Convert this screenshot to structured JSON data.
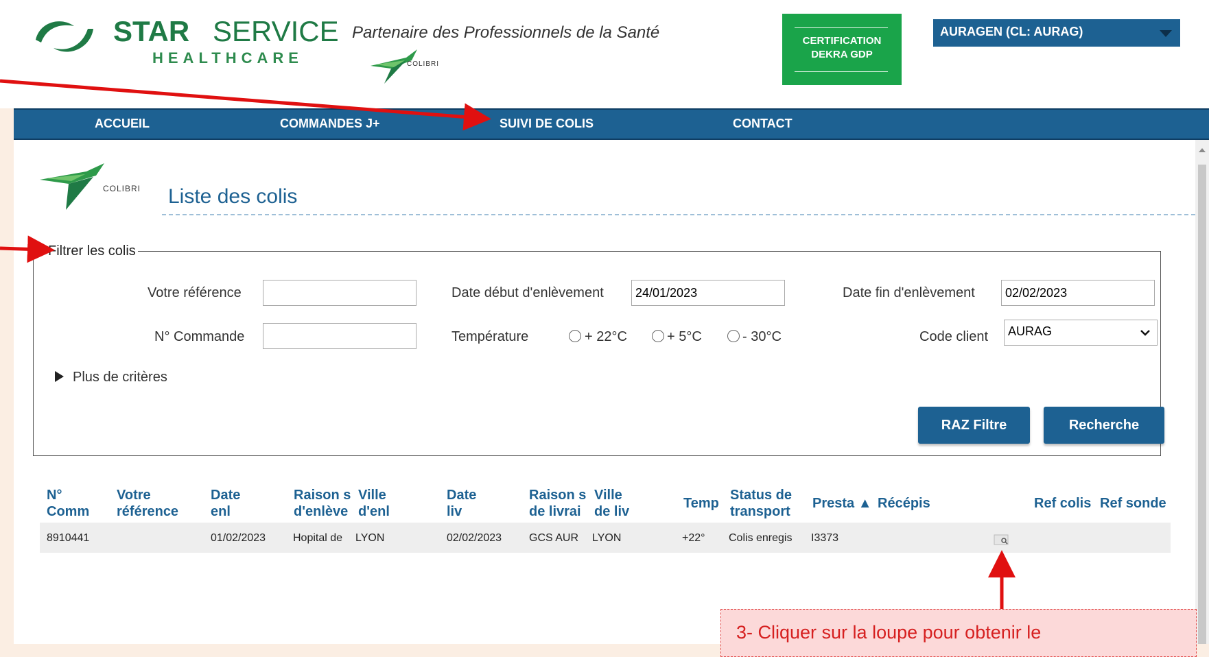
{
  "brand": {
    "name_bold": "STAR",
    "name_light": "SERVICE",
    "subline": "HEALTHCARE",
    "tagline": "Partenaire des Professionnels de la Santé",
    "colibri": "COLIBRI"
  },
  "certification": {
    "line1": "CERTIFICATION",
    "line2": "DEKRA GDP"
  },
  "client_selector": {
    "value": "AURAGEN (CL: AURAG)"
  },
  "nav": {
    "items": [
      "ACCUEIL",
      "COMMANDES J+",
      "SUIVI DE COLIS",
      "CONTACT"
    ]
  },
  "page": {
    "colibri": "COLIBRI",
    "title": "Liste des colis"
  },
  "filter": {
    "legend": "Filtrer les colis",
    "votre_reference_label": "Votre référence",
    "votre_reference_value": "",
    "date_debut_label": "Date début d'enlèvement",
    "date_debut_value": "24/01/2023",
    "date_fin_label": "Date fin d'enlèvement",
    "date_fin_value": "02/02/2023",
    "num_commande_label": "N° Commande",
    "num_commande_value": "",
    "temperature_label": "Température",
    "temperature_options": [
      "+ 22°C",
      "+ 5°C",
      "- 30°C"
    ],
    "code_client_label": "Code client",
    "code_client_value": "AURAG",
    "plus_criteres": "Plus de critères",
    "raz_button": "RAZ Filtre",
    "recherche_button": "Recherche"
  },
  "table": {
    "headers": [
      [
        "N°",
        "Comm"
      ],
      [
        "Votre",
        "référence"
      ],
      [
        "Date",
        "enl"
      ],
      [
        "Raison s",
        "d'enlève"
      ],
      [
        "Ville",
        "d'enl"
      ],
      [
        "Date",
        "liv"
      ],
      [
        "Raison s",
        "de livrai"
      ],
      [
        "Ville",
        "de liv"
      ],
      [
        "Temp",
        ""
      ],
      [
        "Status de",
        "transport"
      ],
      [
        "Presta ▲",
        ""
      ],
      [
        "Récépis",
        ""
      ],
      [
        "Ref colis",
        ""
      ],
      [
        "Ref sonde",
        ""
      ]
    ],
    "rows": [
      {
        "num_comm": "8910441",
        "votre_reference": "",
        "date_enl": "01/02/2023",
        "raison_enl": "Hopital de",
        "ville_enl": "LYON",
        "date_liv": "02/02/2023",
        "raison_liv": "GCS AUR",
        "ville_liv": "LYON",
        "temp": "+22°",
        "status": "Colis enregis",
        "presta": "I3373",
        "recepisse_icon": "magnifier-icon"
      }
    ]
  },
  "annotation": {
    "note": "3- Cliquer sur la loupe pour obtenir le"
  },
  "colors": {
    "brand_green": "#1f7a45",
    "cert_green": "#1aa44a",
    "nav_blue": "#1d6192",
    "annotation_red": "#e01010",
    "page_bg": "#fbeee3"
  }
}
